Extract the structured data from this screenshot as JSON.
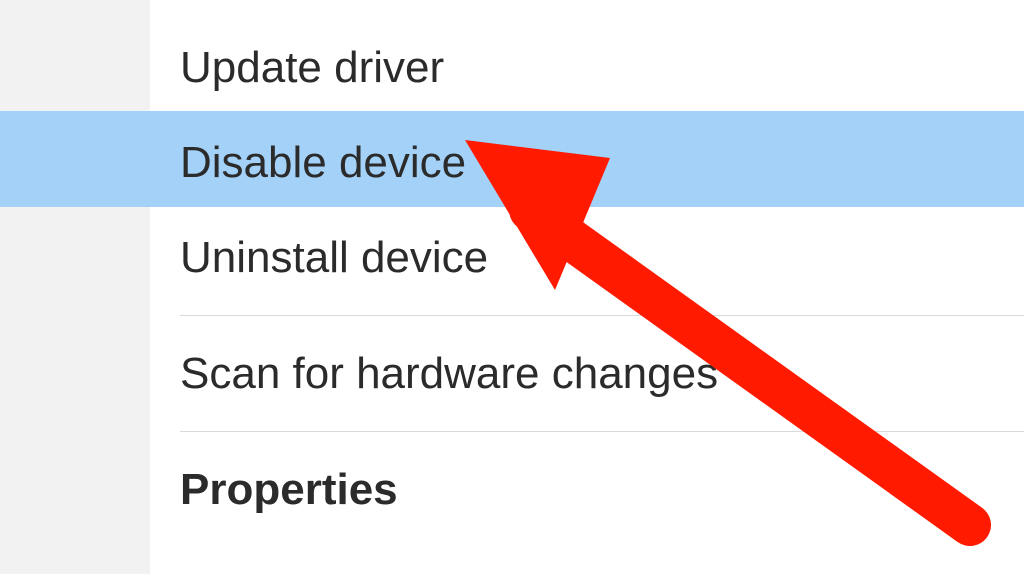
{
  "context_menu": {
    "items": [
      {
        "label": "Update driver",
        "highlighted": false,
        "bold": false
      },
      {
        "label": "Disable device",
        "highlighted": true,
        "bold": false
      },
      {
        "label": "Uninstall device",
        "highlighted": false,
        "bold": false
      },
      {
        "label": "Scan for hardware changes",
        "highlighted": false,
        "bold": false
      },
      {
        "label": "Properties",
        "highlighted": false,
        "bold": true
      }
    ]
  },
  "annotation": {
    "arrow_color": "#ff1a00"
  }
}
